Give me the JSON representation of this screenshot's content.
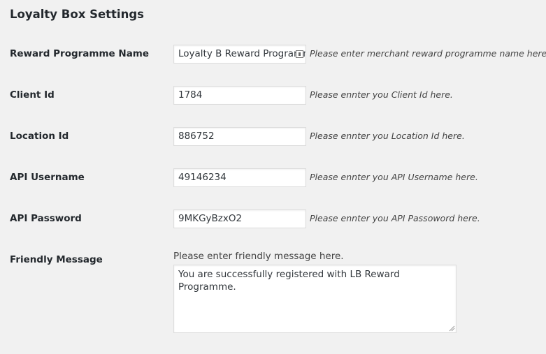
{
  "page": {
    "title": "Loyalty Box Settings"
  },
  "fields": [
    {
      "label": "Reward Programme Name",
      "value": "Loyalty B Reward Programme",
      "hint": "Please enter merchant reward programme name here."
    },
    {
      "label": "Client Id",
      "value": "1784",
      "hint": "Please ennter you Client Id here."
    },
    {
      "label": "Location Id",
      "value": "886752",
      "hint": "Please ennter you Location Id here."
    },
    {
      "label": "API Username",
      "value": "49146234",
      "hint": "Please ennter you API Username here."
    },
    {
      "label": "API Password",
      "value": "9MKGyBzxO2",
      "hint": "Please ennter you API Passoword here."
    }
  ],
  "friendly_message": {
    "label": "Friendly Message",
    "description": "Please enter friendly message here.",
    "value": "You are successfully registered with LB Reward Programme."
  }
}
